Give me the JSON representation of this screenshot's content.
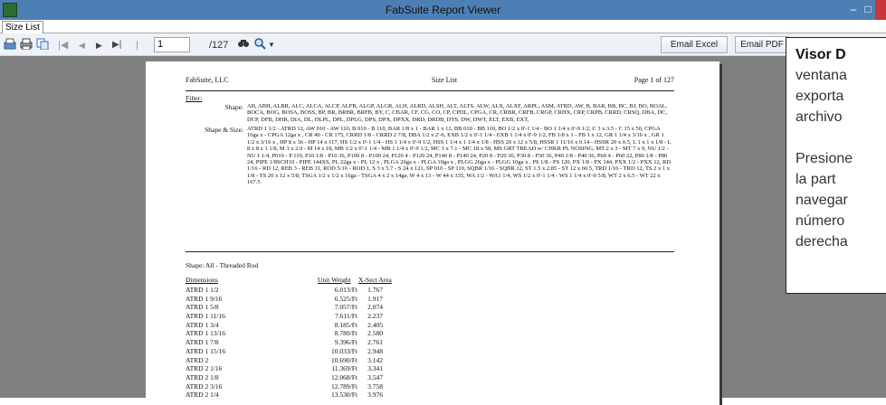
{
  "window": {
    "title": "FabSuite Report Viewer",
    "minimize": "–",
    "maximize": "□",
    "close": "✕"
  },
  "tabs": [
    {
      "label": "Size List"
    }
  ],
  "toolbar": {
    "page_value": "1",
    "page_total": "/127",
    "email_excel": "Email Excel",
    "email_pdf": "Email PDF"
  },
  "report": {
    "company": "FabSuite, LLC",
    "title": "Size List",
    "page_label": "Page 1 of 127",
    "filter_label": "Filter:",
    "shape_key": "Shape:",
    "shape_value": "AB, ABH, ALBR, ALC, ALCA, ALCP, ALFB, ALGP, ALGR, ALH, ALRD, ALSH, ALT, ALTS, ALW, ALX, ALXF, ARPL, ASM, ATRD, AW, B, BAR, BB, BC, BJ, BO, BOAL, BOCA, BOG, BOSA, BOSS, BP, BR, BRBR, BRFB, BY, C, CBAR, CF, CG, CO, CP, CPDL, CPGA, CR, CRBR, CRFB, CRGP, CRHX, CRP, CRPB, CRRD, CRSQ, DBA, DC, DCP, DFB, DHR, DIA, DL, DLPL, DPL, DPLG, DPS, DPX, DPXX, DRD, DRDB, DTS, DW, DWT, ELT, EXB, EXT,",
    "size_key": "Shape & Size:",
    "size_value": "ATRD 1 1/2 - ATRD 12, AW 010 - AW 110, B 010 - B 110, BAR 1/8 x 1 - BAR 1 x 12, BB 010 - BB 110, BO 1/2 x 0'-1 1/4 - BO 1 1/4 x 0'-9 1/2, C 3 x 3.5 - C 15 x 50, CPGA 16ga x - CPGA 12ga x , CR 40 - CR 175, CRRD 1/8 - CRRD 2 7/8, DBA 1/2 x 2'-6, EXB 1/2 x 0'-1 1/4 - EXB 1 1/4 x 0'-9 1/2, FB 1/8 x 1 - FB 1 x 12, GR 1 1/4 x 3/16 x , GR 1 1/2 x 3/16 x , HP 8 x 36 - HP 14 x 117, HS 1/2 x 0'-1 1/4 - HS 1 1/4 x 0'-9 1/2, HSS 1 1/4 x 1 1/4 x 1/8 - HSS 20 x 12 x 5/8, HSSR 1 11/16 x 0.14 - HSSR 20 x 0.5, L 1 x 1 x 1/8 - L 8 x 8 x 1 1/8, M 3 x 2.9 - M 14 x 18, MB 1/2 x 0'-1 1/4 - MB 1 1/4 x 0'-9 1/2, MC 3 x 7.1 - MC 18 x 58, MS GRT TREAD w/ CHKR PL NOSING, MT 2 x 3 - MT 7 x 9, NU 1/2 - NU 1 1/4, P010 - P 110, P10 1/8 - P10 36, P100 8 - P100 24, P120 4 - P120 24, P140 8 - P140 24, P20 8 - P20 36, P30 8 - P30 36, P40 1/8 - P40 36, P60 4 - P60 22, P80 1/8 - P80 24, PIPE 1/8SCH10 - PIPE 144XS, PL 22ga x - PL 12 x , PLGA 26ga x - PLGA 10ga x , PLGG 26ga x - PLGG 10ga x , PS 1/8 - PS 120, PX 1/8 - PX 144, PXX 1/2 - PXX 12, RD 1/16 - RD 12, REB 3 - REB 11, ROD 5/16 - ROD 1, S 3 x 5.7 - S 24 x 121, SP 010 - SP 110, SQBR 1/16 - SQBR 12, ST 1.5 x 2.85 - ST 12 x 60.5, TRD 1/16 - TRD 12, TS 2 x 1 x 1/8 - TS 20 x 12 x 5/8, TSGA 1/2 x 1/2 x 16ga - TSGA 4 x 2 x 14ga, W 4 x 13 - W 44 x 335, WA 1/2 - WA1 1/4, WS 1/2 x 0'-1 1/4 - WS 1 1/4 x 0'-9 5/8, WT 2 x 6.5 - WT 22 x 167.5",
    "shape_group": "Shape: All - Threaded Rod",
    "col_dimensions": "Dimensions",
    "col_unit_weight": "Unit Weight",
    "col_xsect": "X-Sect Area",
    "rows": [
      {
        "dim": "ATRD  1 1/2",
        "wt": "6.013/Ft",
        "area": "1.767"
      },
      {
        "dim": "ATRD  1 9/16",
        "wt": "6.525/Ft",
        "area": "1.917"
      },
      {
        "dim": "ATRD  1 5/8",
        "wt": "7.057/Ft",
        "area": "2.074"
      },
      {
        "dim": "ATRD  1 11/16",
        "wt": "7.611/Ft",
        "area": "2.237"
      },
      {
        "dim": "ATRD  1 3/4",
        "wt": "8.185/Ft",
        "area": "2.405"
      },
      {
        "dim": "ATRD  1 13/16",
        "wt": "8.780/Ft",
        "area": "2.580"
      },
      {
        "dim": "ATRD  1 7/8",
        "wt": "9.396/Ft",
        "area": "2.761"
      },
      {
        "dim": "ATRD  1 15/16",
        "wt": "10.033/Ft",
        "area": "2.948"
      },
      {
        "dim": "ATRD  2",
        "wt": "10.690/Ft",
        "area": "3.142"
      },
      {
        "dim": "ATRD  2 1/16",
        "wt": "11.369/Ft",
        "area": "3.341"
      },
      {
        "dim": "ATRD  2 1/8",
        "wt": "12.068/Ft",
        "area": "3.547"
      },
      {
        "dim": "ATRD  2 3/16",
        "wt": "12.789/Ft",
        "area": "3.758"
      },
      {
        "dim": "ATRD  2 1/4",
        "wt": "13.530/Ft",
        "area": "3.976"
      }
    ]
  },
  "callout": {
    "title": "Visor D",
    "lines": [
      "ventana",
      "exporta",
      "archivo",
      "",
      "Presione",
      "la part",
      "navegar",
      "número",
      "derecha"
    ]
  }
}
